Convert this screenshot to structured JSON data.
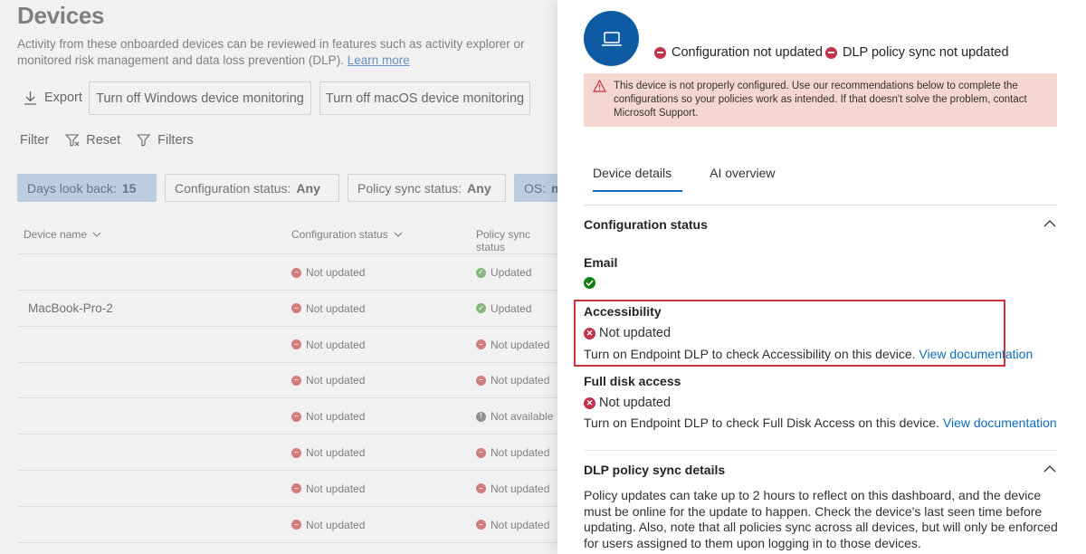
{
  "background_page": {
    "title": "Devices",
    "description": "Activity from these onboarded devices can be reviewed in features such as activity explorer or monitored risk management and data loss prevention (DLP).",
    "learn_more": "Learn more",
    "toolbar": {
      "export_label": "Export",
      "windows_button": "Turn off Windows device monitoring",
      "mac_button": "Turn off macOS device monitoring"
    },
    "filter_bar": {
      "filter_label": "Filter",
      "reset_label": "Reset",
      "filters_label": "Filters"
    },
    "pills": {
      "days": {
        "label": "Days look back:",
        "value": "15"
      },
      "config": {
        "label": "Configuration status:",
        "value": "Any"
      },
      "policy": {
        "label": "Policy sync status:",
        "value": "Any"
      },
      "os": {
        "label": "OS:",
        "value": "m"
      }
    },
    "columns": {
      "device_name": "Device name",
      "config_status": "Configuration status",
      "policy_status": "Policy sync status"
    },
    "rows": [
      {
        "name": "",
        "config": "Not updated",
        "config_state": "bad",
        "policy": "Updated",
        "policy_state": "ok"
      },
      {
        "name": "MacBook-Pro-2",
        "config": "Not updated",
        "config_state": "bad",
        "policy": "Updated",
        "policy_state": "ok"
      },
      {
        "name": "",
        "config": "Not updated",
        "config_state": "bad",
        "policy": "Not updated",
        "policy_state": "bad"
      },
      {
        "name": "",
        "config": "Not updated",
        "config_state": "bad",
        "policy": "Not updated",
        "policy_state": "bad"
      },
      {
        "name": "",
        "config": "Not updated",
        "config_state": "bad",
        "policy": "Not available",
        "policy_state": "na"
      },
      {
        "name": "",
        "config": "Not updated",
        "config_state": "bad",
        "policy": "Not updated",
        "policy_state": "bad"
      },
      {
        "name": "",
        "config": "Not updated",
        "config_state": "bad",
        "policy": "Not updated",
        "policy_state": "bad"
      },
      {
        "name": "",
        "config": "Not updated",
        "config_state": "bad",
        "policy": "Not updated",
        "policy_state": "bad"
      }
    ]
  },
  "panel": {
    "icon": "laptop-icon",
    "status_config": "Configuration not updated",
    "status_dlp": "DLP policy sync not updated",
    "warning": "This device is not properly configured. Use our recommendations below to complete the configurations so your policies work as intended. If that doesn't solve the problem, contact Microsoft Support.",
    "tabs": [
      "Device details",
      "AI overview"
    ],
    "config_section": {
      "title": "Configuration status",
      "email": {
        "label": "Email"
      },
      "accessibility": {
        "label": "Accessibility",
        "status": "Not updated",
        "message": "Turn on Endpoint DLP to check Accessibility on this device.",
        "link": "View documentation"
      },
      "full_disk": {
        "label": "Full disk access",
        "status": "Not updated",
        "message": "Turn on Endpoint DLP to check Full Disk Access on this device.",
        "link": "View documentation"
      }
    },
    "dlp_section": {
      "title": "DLP policy sync details",
      "text": "Policy updates can take up to 2 hours to reflect on this dashboard, and the device must be online for the update to happen. Check the device's last seen time before updating. Also, note that all policies sync across all devices, but will only be enforced for users assigned to them upon logging in to those devices."
    }
  },
  "colors": {
    "accent": "#0f6cbd",
    "error": "#c4314b",
    "success": "#107c10",
    "warning_bg": "#f6d7cf",
    "avatar_bg": "#0f5ba3",
    "highlight_border": "#d13438"
  }
}
